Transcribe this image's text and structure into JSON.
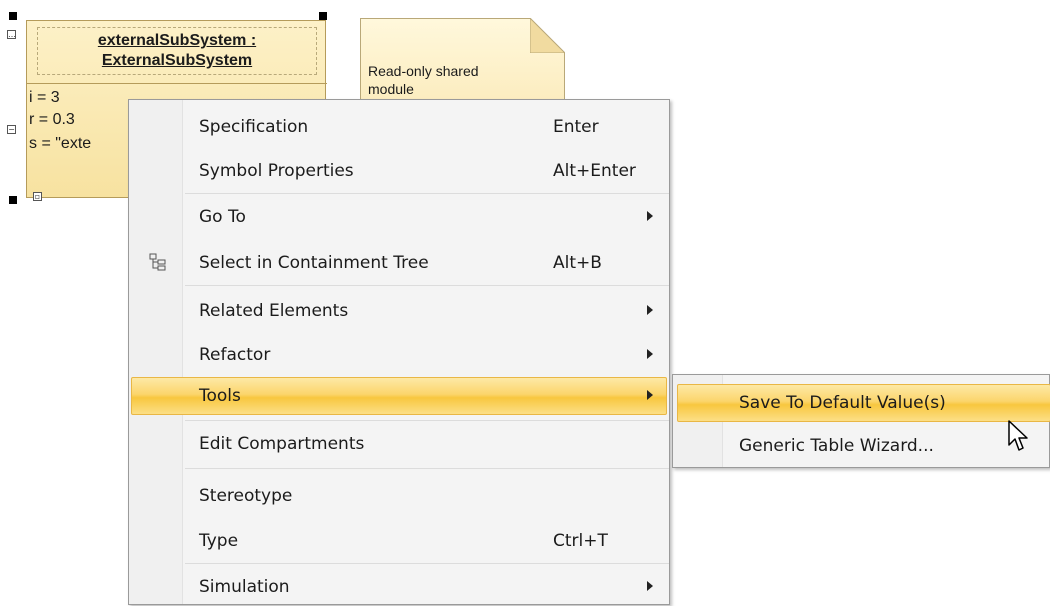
{
  "diagram": {
    "element": {
      "name_line1": "externalSubSystem :",
      "name_line2": "ExternalSubSystem",
      "attributes": [
        "i = 3",
        "r = 0.3",
        "s = \"exte"
      ]
    },
    "note": {
      "text_line1": "Read-only shared",
      "text_line2": "module"
    }
  },
  "context_menu": {
    "items": [
      {
        "label": "Specification",
        "accel": "Enter"
      },
      {
        "label": "Symbol Properties",
        "accel": "Alt+Enter"
      },
      {
        "label": "Go To",
        "accel": ""
      },
      {
        "label": "Select in Containment Tree",
        "accel": "Alt+B"
      },
      {
        "label": "Related Elements",
        "accel": ""
      },
      {
        "label": "Refactor",
        "accel": ""
      },
      {
        "label": "Tools",
        "accel": ""
      },
      {
        "label": "Edit Compartments",
        "accel": ""
      },
      {
        "label": "Stereotype",
        "accel": ""
      },
      {
        "label": "Type",
        "accel": "Ctrl+T"
      },
      {
        "label": "Simulation",
        "accel": ""
      }
    ]
  },
  "tools_submenu": {
    "items": [
      {
        "label": "Save To Default Value(s)"
      },
      {
        "label": "Generic Table Wizard..."
      }
    ]
  },
  "colors": {
    "highlight": "#f8c73f",
    "element_fill": "#f7e2a0",
    "note_fill": "#fbe9b6"
  },
  "icons": [
    "containment-tree-icon",
    "submenu-arrow-icon",
    "mouse-pointer-icon"
  ]
}
